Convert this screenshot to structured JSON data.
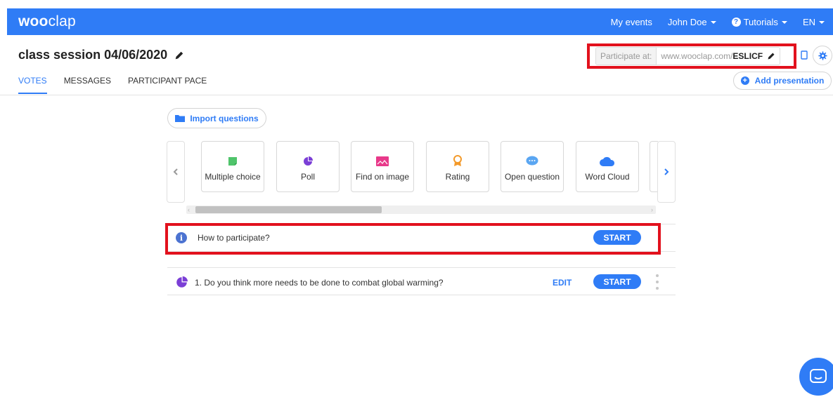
{
  "navbar": {
    "logo_bold": "woo",
    "logo_rest": "clap",
    "my_events": "My events",
    "user": "John Doe",
    "tutorials": "Tutorials",
    "language": "EN"
  },
  "session": {
    "title": "class session 04/06/2020"
  },
  "participate": {
    "label": "Participate at:",
    "url_prefix": "www.wooclap.com/",
    "code": "ESLICF"
  },
  "tabs": [
    {
      "label": "VOTES",
      "active": true
    },
    {
      "label": "MESSAGES",
      "active": false
    },
    {
      "label": "PARTICIPANT PACE",
      "active": false
    }
  ],
  "add_presentation": "Add presentation",
  "import_questions": "Import questions",
  "question_types": [
    {
      "label": "Multiple choice",
      "icon": "multiple-choice-icon",
      "color": "#4fc46b"
    },
    {
      "label": "Poll",
      "icon": "poll-icon",
      "color": "#7b3fd6"
    },
    {
      "label": "Find on image",
      "icon": "image-icon",
      "color": "#e8398a"
    },
    {
      "label": "Rating",
      "icon": "rating-icon",
      "color": "#f39a2b"
    },
    {
      "label": "Open question",
      "icon": "chat-bubble-icon",
      "color": "#5aa6f2"
    },
    {
      "label": "Word Cloud",
      "icon": "cloud-icon",
      "color": "#2f7cf6"
    }
  ],
  "rows": {
    "how_to": {
      "label": "How to participate?",
      "start": "START"
    },
    "question": {
      "number": "1.",
      "text": "Do you think more needs to be done to combat global warming?",
      "edit": "EDIT",
      "start": "START"
    }
  },
  "colors": {
    "brand": "#2f7cf6",
    "highlight": "#e2111d"
  }
}
